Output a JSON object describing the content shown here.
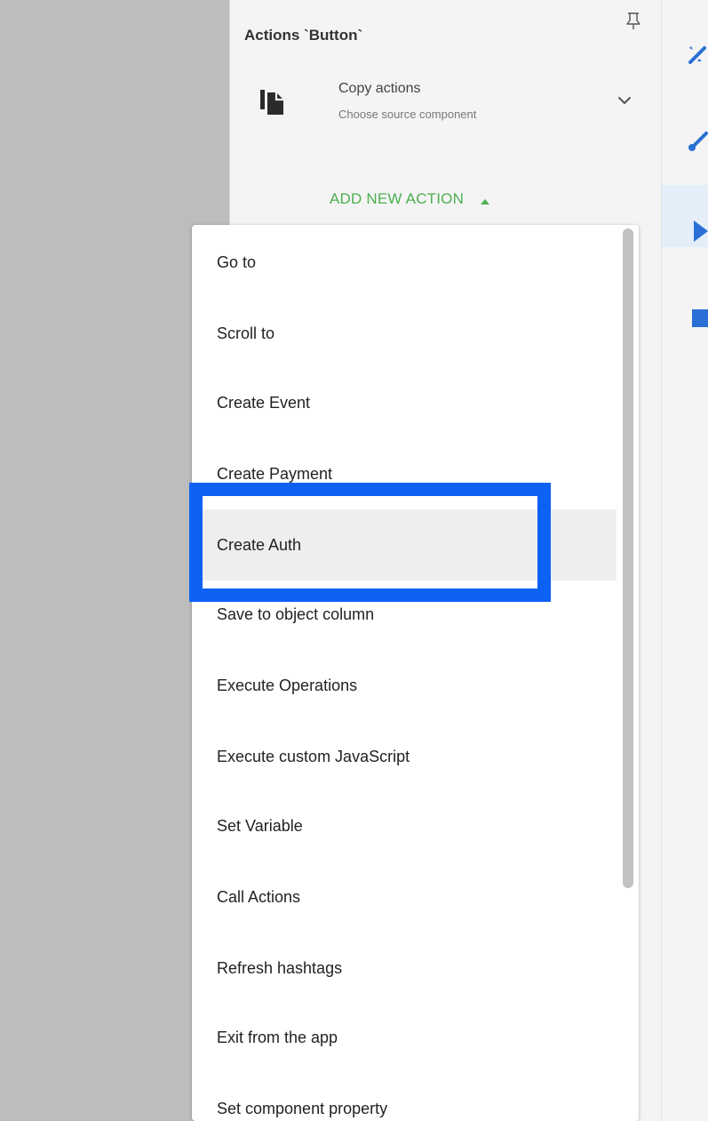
{
  "panel": {
    "title": "Actions `Button`",
    "copy_actions": {
      "title": "Copy actions",
      "subtitle": "Choose source component",
      "icon": "copy-file-icon"
    },
    "add_new_action_label": "ADD NEW ACTION"
  },
  "dropdown": {
    "items": [
      {
        "label": "Go to"
      },
      {
        "label": "Scroll to"
      },
      {
        "label": "Create Event"
      },
      {
        "label": "Create Payment"
      },
      {
        "label": "Create Auth",
        "hovered": true
      },
      {
        "label": "Save to object column"
      },
      {
        "label": "Execute Operations"
      },
      {
        "label": "Execute custom JavaScript"
      },
      {
        "label": "Set Variable"
      },
      {
        "label": "Call Actions"
      },
      {
        "label": "Refresh hashtags"
      },
      {
        "label": "Exit from the app"
      },
      {
        "label": "Set component property"
      }
    ]
  },
  "rail": {
    "items": [
      {
        "icon": "magic-wand-icon",
        "active": false
      },
      {
        "icon": "paint-brush-icon",
        "active": false
      },
      {
        "icon": "play-icon",
        "active": true
      },
      {
        "icon": "database-icon",
        "active": false
      }
    ]
  },
  "colors": {
    "accent_green": "#4caf50",
    "rail_icon_blue": "#2a6fd6",
    "highlight_blue": "#0d62f5",
    "hover_gray": "#eeeeee",
    "canvas_gray": "#bdbdbd"
  }
}
